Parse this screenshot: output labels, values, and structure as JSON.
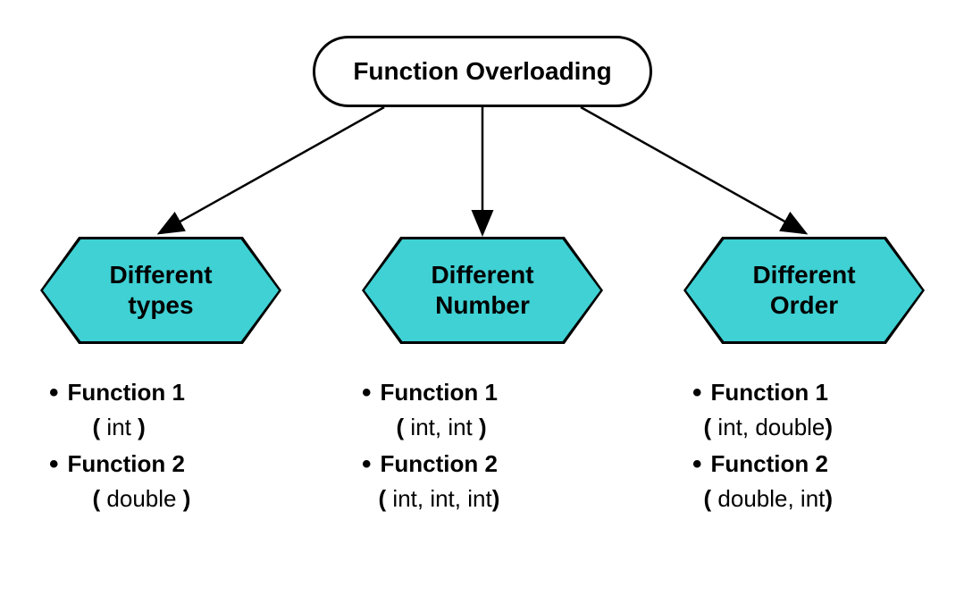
{
  "root": {
    "title": "Function Overloading"
  },
  "branches": [
    {
      "title_line1": "Different",
      "title_line2": "types",
      "items": [
        {
          "name": "Function 1",
          "sig": " int "
        },
        {
          "name": "Function 2",
          "sig": " double "
        }
      ]
    },
    {
      "title_line1": "Different",
      "title_line2": "Number",
      "items": [
        {
          "name": "Function 1",
          "sig": " int, int "
        },
        {
          "name": "Function 2",
          "sig": " int, int,  int"
        }
      ]
    },
    {
      "title_line1": "Different",
      "title_line2": "Order",
      "items": [
        {
          "name": "Function 1",
          "sig": " int, double"
        },
        {
          "name": "Function 2",
          "sig": " double, int"
        }
      ]
    }
  ],
  "colors": {
    "hexFill": "#3fd1d4"
  }
}
